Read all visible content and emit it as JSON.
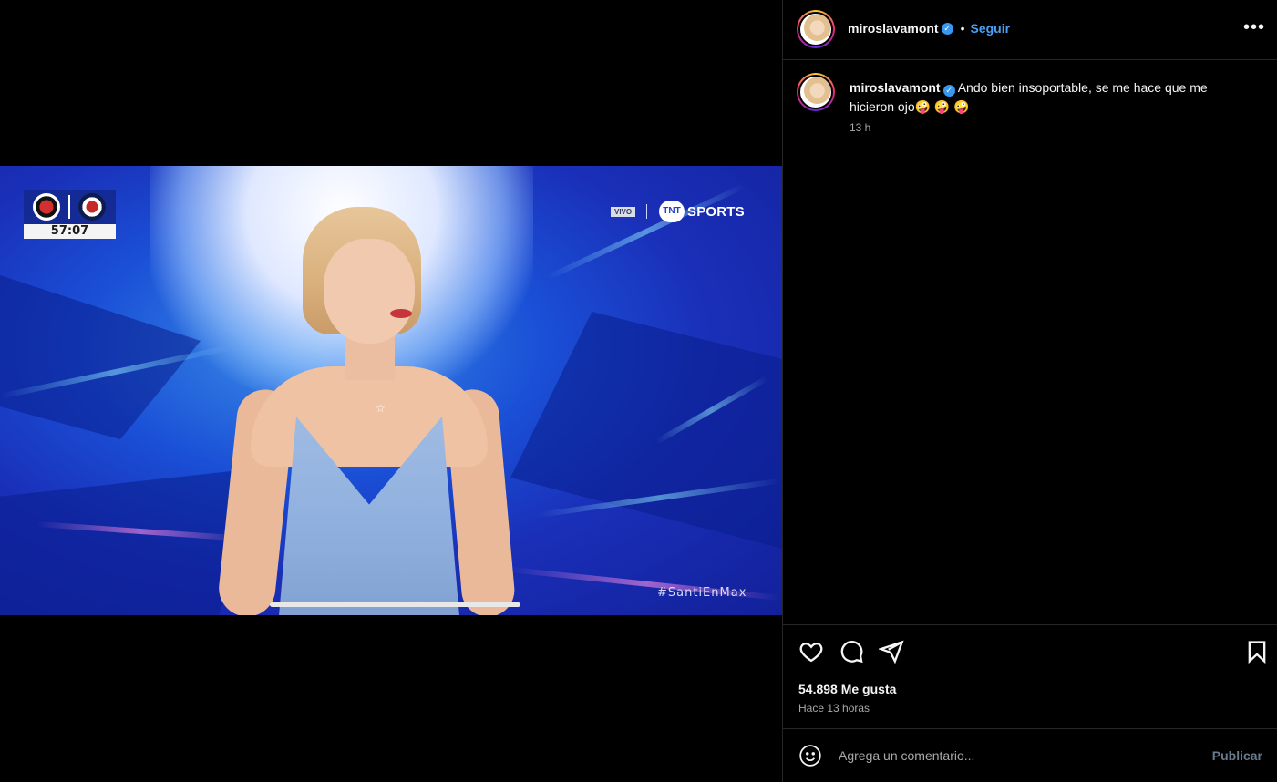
{
  "post": {
    "username": "miroslavamont",
    "verified_icon": "verified-badge-icon",
    "separator": "•",
    "follow_label": "Seguir",
    "more_label": "•••",
    "caption_text": "Ando bien insoportable, se me hace que me hicieron ojo🤪 🤪 🤪",
    "caption_time": "13 h",
    "likes_label": "54.898 Me gusta",
    "posted_ago": "Hace 13 horas",
    "comment_placeholder": "Agrega un comentario...",
    "publish_label": "Publicar"
  },
  "video": {
    "match_clock": "57:07",
    "live_tag": "VIVO",
    "broadcaster_short": "TNT",
    "broadcaster_suffix": "SPORTS",
    "hashtag": "#SantiEnMax",
    "progress": 1.0
  },
  "colors": {
    "accent_blue": "#4a9ff5",
    "verified_blue": "#3897f0",
    "background": "#000000",
    "secondary_text": "#a8a8a8"
  }
}
